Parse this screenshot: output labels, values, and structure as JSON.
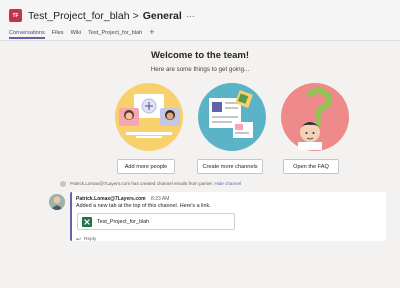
{
  "header": {
    "team_avatar_text": "TF",
    "team_name": "Test_Project_for_blah",
    "separator": ">",
    "channel_name": "General",
    "more_icon": "more-options-icon",
    "tabs": [
      {
        "label": "Conversations",
        "active": true
      },
      {
        "label": "Files",
        "active": false
      },
      {
        "label": "Wiki",
        "active": false
      },
      {
        "label": "Test_Project_for_blah",
        "active": false
      }
    ],
    "add_tab_icon": "+"
  },
  "welcome": {
    "title": "Welcome to the team!",
    "subtitle": "Here are some things to get going...",
    "buttons": [
      {
        "label": "Add more people"
      },
      {
        "label": "Create more channels"
      },
      {
        "label": "Open the FAQ"
      }
    ]
  },
  "system_message": {
    "text": "Patrick.Lomax@7Layers.com has created channel emails from parser.",
    "action_link": "Hide channel"
  },
  "post": {
    "author": "Patrick.Lomax@7Layers.com",
    "time": "8:23 AM",
    "body": "Added a new tab at the top of this channel. Here's a link.",
    "tab_link_label": "Test_Project_for_blah",
    "reply_label": "Reply"
  },
  "colors": {
    "accent": "#6264a7",
    "team_avatar": "#c4314b",
    "background": "#f3f2f1"
  }
}
